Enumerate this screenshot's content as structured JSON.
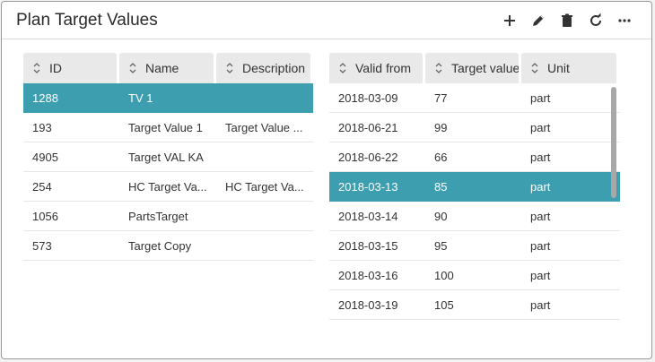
{
  "header": {
    "title": "Plan Target Values",
    "actions": [
      {
        "name": "add",
        "icon": "plus-icon"
      },
      {
        "name": "edit",
        "icon": "pencil-icon"
      },
      {
        "name": "delete",
        "icon": "trash-icon"
      },
      {
        "name": "refresh",
        "icon": "refresh-icon"
      },
      {
        "name": "more",
        "icon": "more-icon"
      }
    ]
  },
  "colors": {
    "selected_row": "#3d9eb0",
    "header_cell": "#e9e9e9"
  },
  "left_table": {
    "columns": [
      "ID",
      "Name",
      "Description"
    ],
    "rows": [
      {
        "id": "1288",
        "name": "TV 1",
        "description": "",
        "selected": true
      },
      {
        "id": "193",
        "name": "Target Value 1",
        "description": "Target Value ...",
        "selected": false
      },
      {
        "id": "4905",
        "name": "Target VAL KA",
        "description": "",
        "selected": false
      },
      {
        "id": "254",
        "name": "HC Target Va...",
        "description": "HC Target Va...",
        "selected": false
      },
      {
        "id": "1056",
        "name": "PartsTarget",
        "description": "",
        "selected": false
      },
      {
        "id": "573",
        "name": "Target Copy",
        "description": "",
        "selected": false
      }
    ]
  },
  "right_table": {
    "columns": [
      "Valid from",
      "Target value",
      "Unit"
    ],
    "rows": [
      {
        "valid_from": "2018-03-09",
        "target_value": "77",
        "unit": "part",
        "selected": false
      },
      {
        "valid_from": "2018-06-21",
        "target_value": "99",
        "unit": "part",
        "selected": false
      },
      {
        "valid_from": "2018-06-22",
        "target_value": "66",
        "unit": "part",
        "selected": false
      },
      {
        "valid_from": "2018-03-13",
        "target_value": "85",
        "unit": "part",
        "selected": true
      },
      {
        "valid_from": "2018-03-14",
        "target_value": "90",
        "unit": "part",
        "selected": false
      },
      {
        "valid_from": "2018-03-15",
        "target_value": "95",
        "unit": "part",
        "selected": false
      },
      {
        "valid_from": "2018-03-16",
        "target_value": "100",
        "unit": "part",
        "selected": false
      },
      {
        "valid_from": "2018-03-19",
        "target_value": "105",
        "unit": "part",
        "selected": false
      }
    ]
  }
}
